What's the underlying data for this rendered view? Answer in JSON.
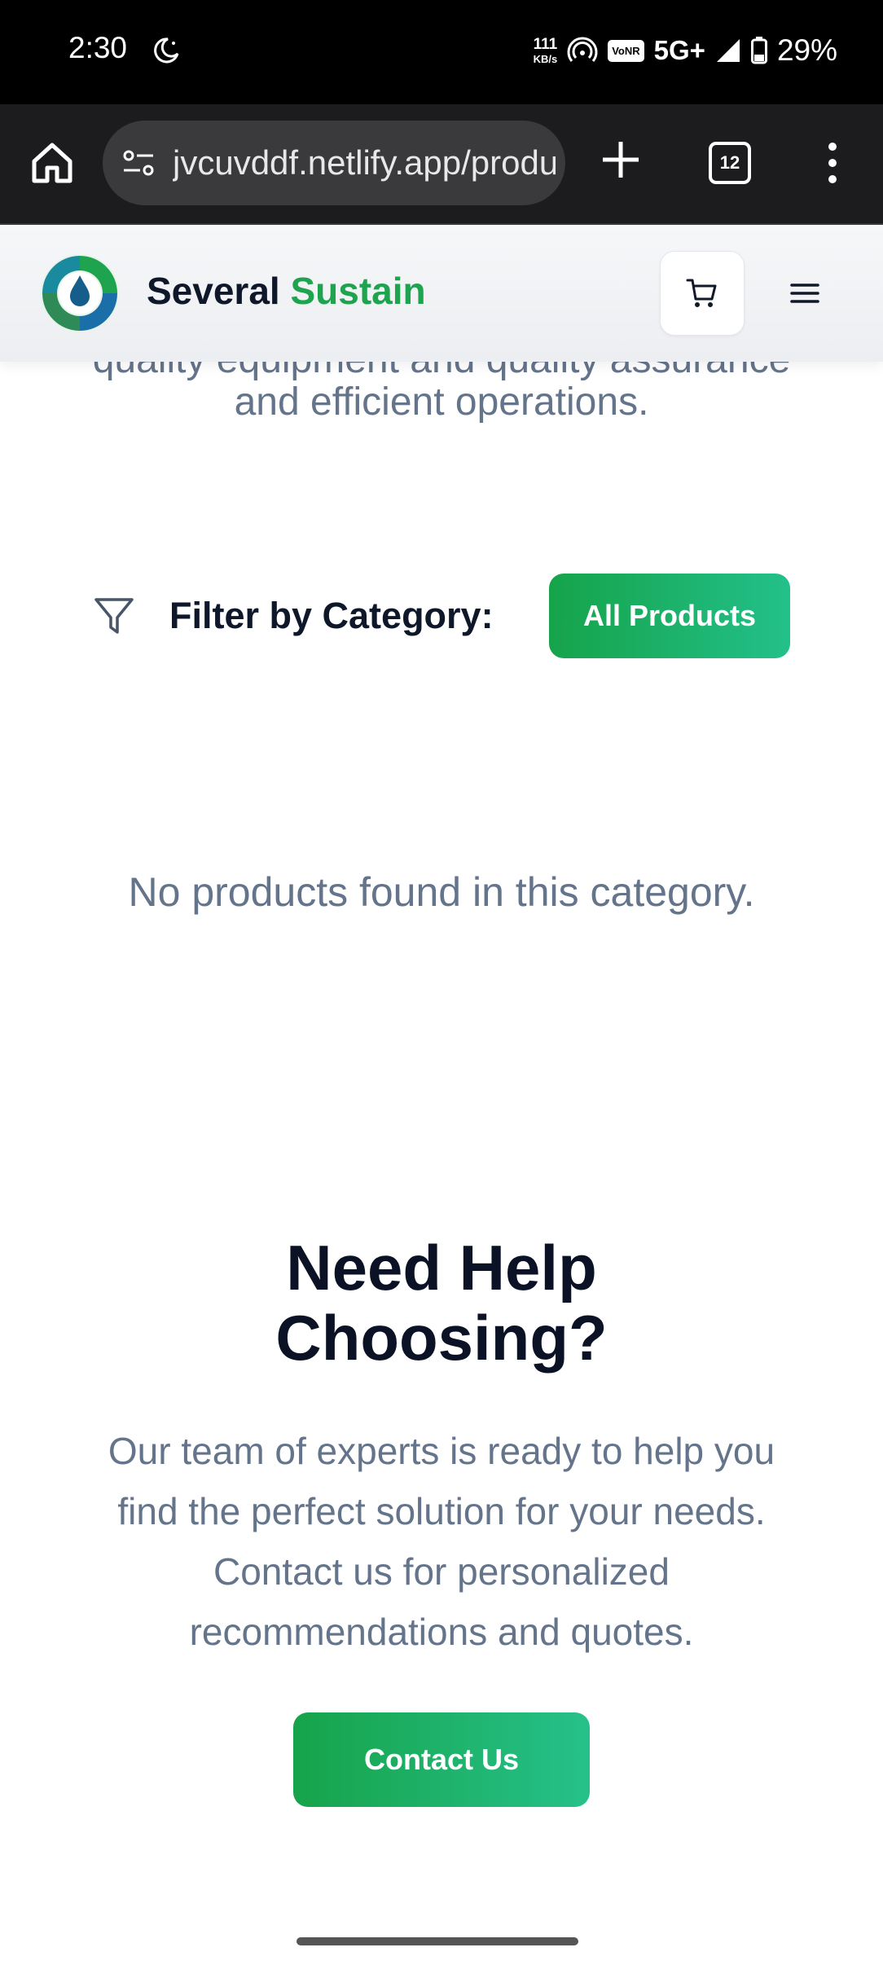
{
  "status_bar": {
    "time": "2:30",
    "speed_value": "111",
    "speed_unit": "KB/s",
    "vonr": "VoNR",
    "network": "5G+",
    "battery": "29%"
  },
  "browser": {
    "url": "jvcuvddf.netlify.app/products",
    "tab_count": "12"
  },
  "header": {
    "brand_first": "Several",
    "brand_second": "Sustain",
    "brand_colors": {
      "dark": "#0f172a",
      "accent": "#1ea34f"
    }
  },
  "main": {
    "intro_clipped": "quality equipment and quality assurance",
    "intro_visible": "and efficient operations.",
    "filter": {
      "label": "Filter by Category:",
      "selected": "All Products"
    },
    "empty_message": "No products found in this category.",
    "help": {
      "title_line1": "Need Help",
      "title_line2": "Choosing?",
      "text": "Our team of experts is ready to help you find the perfect solution for your needs. Contact us for personalized recommendations and quotes.",
      "button": "Contact Us"
    }
  },
  "icons": {
    "moon": "moon-icon",
    "home": "home-icon",
    "site_info": "site-info-icon",
    "new_tab": "plus-icon",
    "menu": "more-vert-icon",
    "cart": "cart-icon",
    "hamburger": "menu-icon",
    "filter": "filter-icon"
  }
}
